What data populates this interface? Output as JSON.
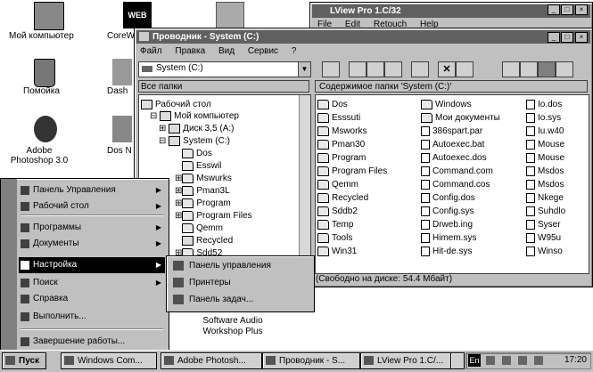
{
  "desktop": {
    "icons": [
      {
        "label": "Мой компьютер"
      },
      {
        "label": "CoreW"
      },
      {
        "label": "Помойка"
      },
      {
        "label": "Dash"
      },
      {
        "label": "Adobe Photoshop 3.0"
      },
      {
        "label": "Dos N"
      },
      {
        "label": "Software Audio Workshop Plus"
      }
    ],
    "web_icon_text": "WEB"
  },
  "lview": {
    "title": "LView Pro 1.C/32",
    "menu": [
      "File",
      "Edit",
      "Retouch",
      "Help"
    ]
  },
  "explorer": {
    "title": "Проводник - System (C:)",
    "menu": [
      "Файл",
      "Правка",
      "Вид",
      "Сервис",
      "?"
    ],
    "drive_select": "System (C:)",
    "left_header": "Все папки",
    "right_header": "Содержимое папки 'System (C:)'",
    "tree": [
      "Рабочий стол",
      "Мой компьютер",
      "Диск 3,5 (A:)",
      "System (C:)",
      "Dos",
      "Esswil",
      "Mswurks",
      "Pman3L",
      "Program",
      "Program Files",
      "Qemm",
      "Recycled",
      "Sdd52"
    ],
    "files_col1": [
      "Dos",
      "Esssuti",
      "Msworks",
      "Pman30",
      "Program",
      "Program Files",
      "Qemm",
      "Recycled",
      "Sddb2",
      "Temp",
      "Tools",
      "Win31"
    ],
    "files_col2": [
      "Windows",
      "Мои документы",
      "386spart.par",
      "Autoexec.bat",
      "Autoexec.dos",
      "Command.com",
      "Command.cos",
      "Config.dos",
      "Config.sys",
      "Drweb.ing",
      "Himem.sys",
      "Hit-de.sys"
    ],
    "files_col3": [
      "Io.dos",
      "Io.sys",
      "Iu.w40",
      "Mouse",
      "Mouse",
      "Msdos",
      "Msdos",
      "Nkege",
      "Suhdlo",
      "Syser",
      "W95u",
      "Winso"
    ],
    "status": "йт (Свободно на диске: 54.4 Мбайт)"
  },
  "startmenu": {
    "items": [
      {
        "label": "Панель Управления",
        "arrow": "▶"
      },
      {
        "label": "Рабочий стол",
        "arrow": "▶"
      },
      {
        "label": "Программы",
        "arrow": "▶"
      },
      {
        "label": "Документы",
        "arrow": "▶"
      },
      {
        "label": "Настройка",
        "arrow": "▶"
      },
      {
        "label": "Поиск",
        "arrow": "▶"
      },
      {
        "label": "Справка",
        "arrow": ""
      },
      {
        "label": "Выполнить...",
        "arrow": ""
      },
      {
        "label": "Завершение работы...",
        "arrow": ""
      }
    ],
    "submenu": [
      "Панель управления",
      "Принтеры",
      "Панель задач..."
    ]
  },
  "taskbar": {
    "start_label": "Пуск",
    "buttons": [
      "Windows Com...",
      "Adobe Photosh...",
      "Проводник - S...",
      "LView Pro 1.C/...",
      ""
    ],
    "lang": "En",
    "time": "17:20"
  }
}
